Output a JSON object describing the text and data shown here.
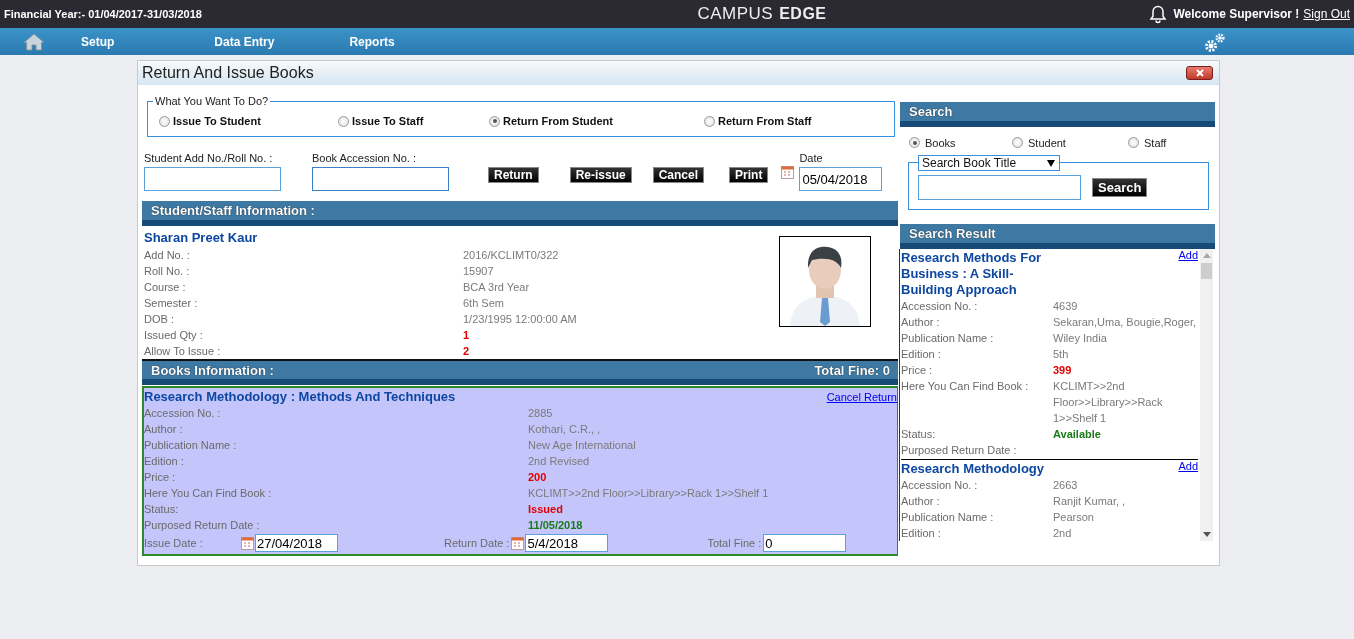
{
  "header": {
    "financial_year": "Financial Year:- 01/04/2017-31/03/2018",
    "logo_first": "CAMPUS",
    "logo_second": "EDGE",
    "welcome": "Welcome Supervisor !",
    "sign_out": "Sign Out"
  },
  "nav": {
    "items": [
      "Setup",
      "Data Entry",
      "Reports"
    ]
  },
  "dialog": {
    "title": "Return And Issue Books"
  },
  "action_choice": {
    "legend": "What You Want To Do?",
    "options": [
      {
        "label": "Issue To Student",
        "selected": false
      },
      {
        "label": "Issue To Staff",
        "selected": false
      },
      {
        "label": "Return From Student",
        "selected": true
      },
      {
        "label": "Return From Staff",
        "selected": false
      }
    ]
  },
  "student_field": {
    "label": "Student Add No./Roll No. :"
  },
  "accession_field": {
    "label": "Book Accession No. :"
  },
  "buttons": [
    "Return",
    "Re-issue",
    "Cancel",
    "Print"
  ],
  "date_field": {
    "label": "Date",
    "value": "05/04/2018"
  },
  "student_info": {
    "heading": "Student/Staff Information :",
    "name": "Sharan Preet Kaur",
    "rows": [
      {
        "label": "Add No. :",
        "value": "2016/KCLIMT0/322",
        "kind": "plain"
      },
      {
        "label": "Roll No. :",
        "value": "15907",
        "kind": "plain"
      },
      {
        "label": "Course :",
        "value": "BCA 3rd Year",
        "kind": "plain"
      },
      {
        "label": "Semester :",
        "value": "6th Sem",
        "kind": "plain"
      },
      {
        "label": "DOB :",
        "value": "1/23/1995 12:00:00 AM",
        "kind": "plain"
      },
      {
        "label": "Issued Qty :",
        "value": "1",
        "kind": "alert"
      },
      {
        "label": "Allow To Issue :",
        "value": "2",
        "kind": "alert"
      }
    ]
  },
  "books_info": {
    "heading": "Books Information :",
    "total_fine": "Total Fine: 0",
    "books": [
      {
        "title": "Research Methodology : Methods And Techniques",
        "action": "Cancel Return",
        "rows": [
          {
            "label": "Accession No. :",
            "value": "2885",
            "kind": "plain"
          },
          {
            "label": "Author :",
            "value": "Kothari, C.R., ,",
            "kind": "plain"
          },
          {
            "label": "Publication Name :",
            "value": "New Age International",
            "kind": "plain"
          },
          {
            "label": "Edition :",
            "value": "2nd Revised",
            "kind": "plain"
          },
          {
            "label": "Price :",
            "value": "200",
            "kind": "alert"
          },
          {
            "label": "Here You Can Find Book :",
            "value": "KCLIMT>>2nd Floor>>Library>>Rack 1>>Shelf 1",
            "kind": "plain"
          },
          {
            "label": "Status:",
            "value": "Issued",
            "kind": "alert"
          },
          {
            "label": "Purposed Return Date :",
            "value": "11/05/2018",
            "kind": "ok"
          }
        ],
        "issue_date_label": "Issue Date :",
        "issue_date": "27/04/2018",
        "return_date_label": "Return Date :",
        "return_date": "5/4/2018",
        "fine_label": "Total Fine :",
        "fine": "0"
      }
    ]
  },
  "search": {
    "heading": "Search",
    "options": [
      {
        "label": "Books",
        "selected": true
      },
      {
        "label": "Student",
        "selected": false
      },
      {
        "label": "Staff",
        "selected": false
      }
    ],
    "select": "Search Book Title",
    "button": "Search"
  },
  "search_result": {
    "heading": "Search Result",
    "items": [
      {
        "title": "Research Methods For Business : A Skill-Building Approach",
        "action": "Add",
        "rows": [
          {
            "label": "Accession No. :",
            "value": "4639",
            "kind": "plain"
          },
          {
            "label": "Author :",
            "value": "Sekaran,Uma, Bougie,Roger,",
            "kind": "plain"
          },
          {
            "label": "Publication Name :",
            "value": "Wiley India",
            "kind": "plain"
          },
          {
            "label": "Edition :",
            "value": "5th",
            "kind": "plain"
          },
          {
            "label": "Price :",
            "value": "399",
            "kind": "alert"
          },
          {
            "label": "Here You Can Find Book :",
            "value": "KCLIMT>>2nd Floor>>Library>>Rack 1>>Shelf 1",
            "kind": "plain"
          },
          {
            "label": "Status:",
            "value": "Available",
            "kind": "ok"
          },
          {
            "label": "Purposed Return Date :"
          }
        ]
      },
      {
        "title": "Research Methodology",
        "action": "Add",
        "rows": [
          {
            "label": "Accession No. :",
            "value": "2663",
            "kind": "plain"
          },
          {
            "label": "Author :",
            "value": "Ranjit Kumar, ,",
            "kind": "plain"
          },
          {
            "label": "Publication Name :",
            "value": "Pearson",
            "kind": "plain"
          },
          {
            "label": "Edition :",
            "value": "2nd",
            "kind": "plain"
          }
        ]
      }
    ]
  }
}
